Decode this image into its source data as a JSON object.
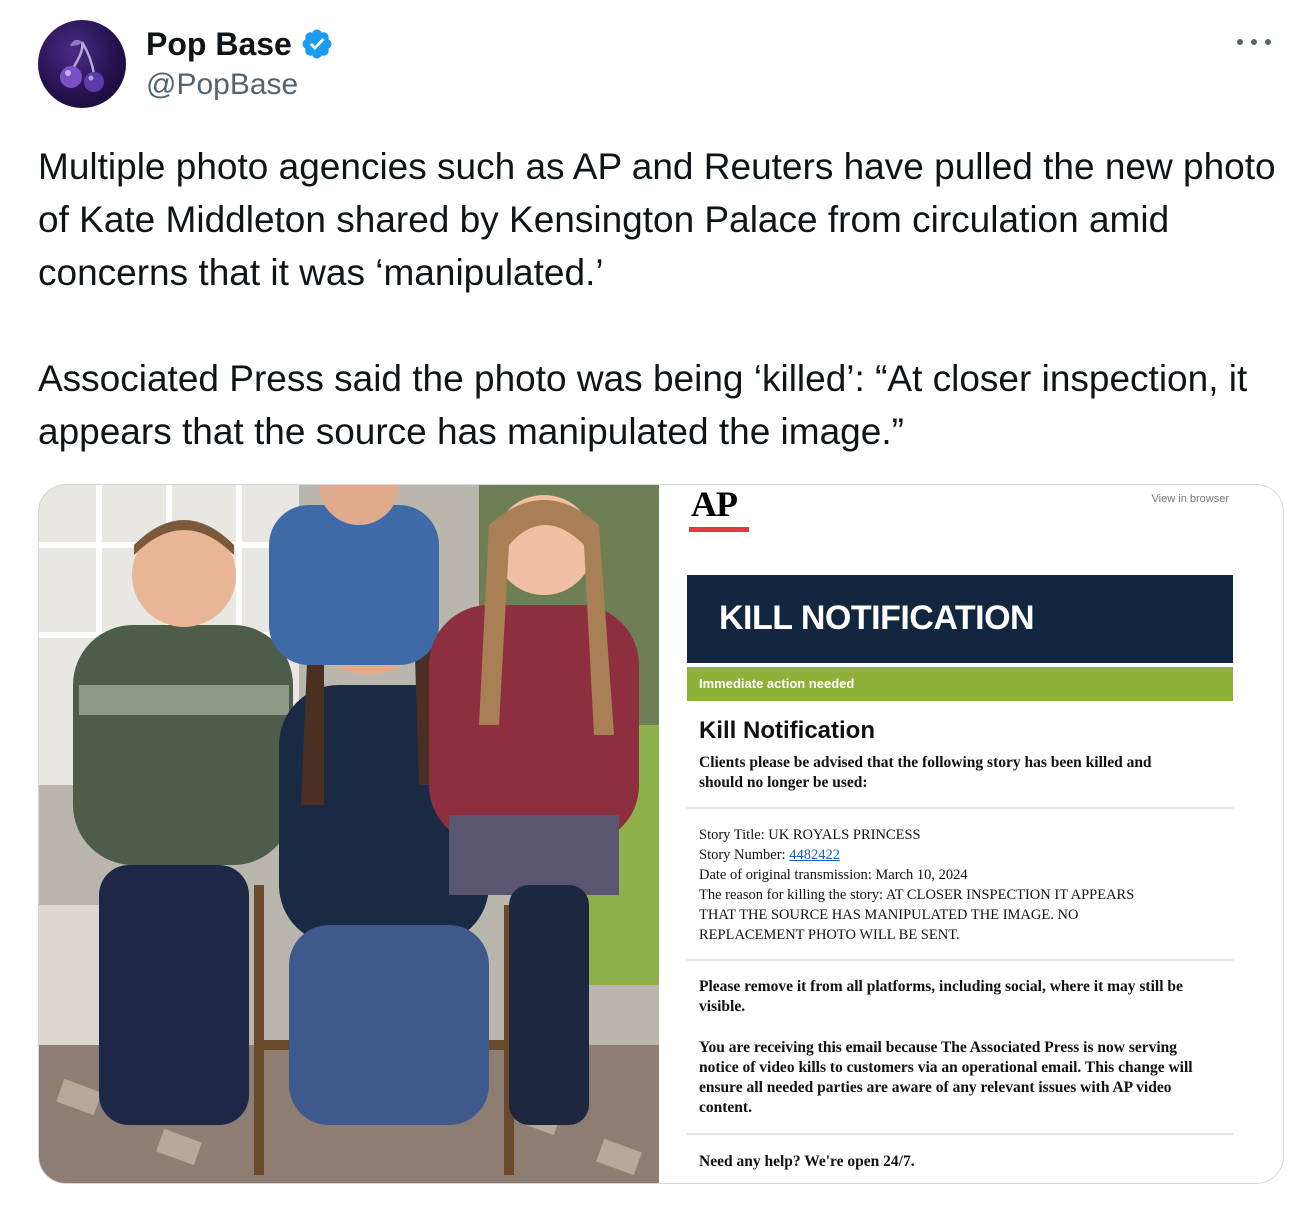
{
  "author": {
    "display_name": "Pop Base",
    "handle": "@PopBase",
    "avatar_icon": "cherry-icon",
    "verified_icon": "verified-badge-icon",
    "verified_color": "#1d9bf0"
  },
  "more_icon": "more-horizontal-icon",
  "tweet_text": {
    "paragraph_1": "Multiple photo agencies such as AP and Reuters have pulled the new photo of Kate Middleton shared by Kensington Palace from circulation amid concerns that it was ‘manipulated.’",
    "paragraph_2": "Associated Press said the photo was being ‘killed’: “At closer inspection, it appears that the source has manipulated the image.”"
  },
  "media": {
    "photo_description_icon": "family-photo",
    "ap_email": {
      "logo": "AP",
      "view_in_browser": "View in browser",
      "banner": "KILL NOTIFICATION",
      "action_bar": "Immediate action needed",
      "title": "Kill Notification",
      "intro": "Clients please be advised that the following story has been killed and should no longer be used:",
      "story_title_label": "Story Title: UK ROYALS PRINCESS",
      "story_number_label": "Story Number: ",
      "story_number": "4482422",
      "date_line": "Date of original transmission: March 10, 2024",
      "reason_line_1": "The reason for killing the story: AT CLOSER INSPECTION IT APPEARS",
      "reason_line_2": "THAT THE SOURCE HAS MANIPULATED THE IMAGE. NO",
      "reason_line_3": "REPLACEMENT PHOTO WILL BE SENT.",
      "remove_text": "Please remove it from all platforms, including social, where it may still be visible.",
      "receiving_text": "You are receiving this email because The Associated Press is now serving notice of video kills to customers via an operational email. This change will ensure all needed parties are aware of any relevant issues with AP video content.",
      "help_text": "Need any help? We're open 24/7.",
      "banner_color": "#12263f",
      "action_color": "#8fb13a",
      "logo_bar_color": "#e03a3e"
    }
  }
}
